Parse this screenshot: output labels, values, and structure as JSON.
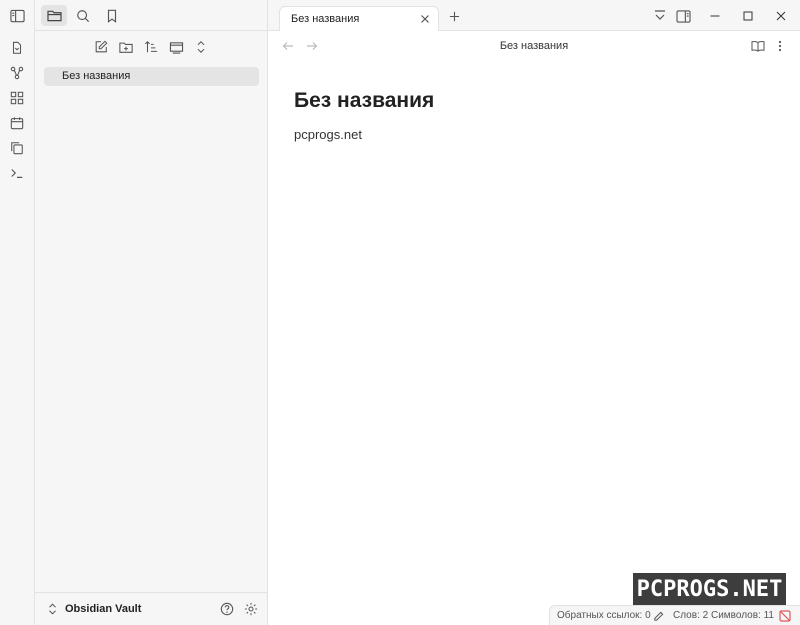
{
  "sidebar": {
    "file_items": [
      {
        "label": "Без названия"
      }
    ],
    "vault_name": "Obsidian Vault"
  },
  "tabs": [
    {
      "title": "Без названия"
    }
  ],
  "view_header": {
    "title": "Без названия"
  },
  "editor": {
    "heading": "Без названия",
    "body_line": "pcprogs.net"
  },
  "watermark": {
    "text": "PCPROGS.NET"
  },
  "statusbar": {
    "backlinks": "Обратных ссылок: 0",
    "words": "Слов: 2",
    "chars": "Символов: 11"
  },
  "icons": {
    "ribbon": [
      "open-quick-switcher-icon",
      "graph-view-icon",
      "canvas-icon",
      "daily-note-icon",
      "templates-icon",
      "command-palette-icon"
    ],
    "side_tabs": [
      "sidebar-toggle-icon",
      "files-icon",
      "search-icon",
      "bookmarks-icon"
    ],
    "nav_actions": [
      "new-note-icon",
      "new-folder-icon",
      "sort-icon",
      "auto-reveal-icon",
      "collapse-all-icon"
    ]
  },
  "colors": {
    "accent_red": "#e0565b",
    "panel_bg": "#f6f6f6",
    "active_bg": "#e4e4e4"
  }
}
